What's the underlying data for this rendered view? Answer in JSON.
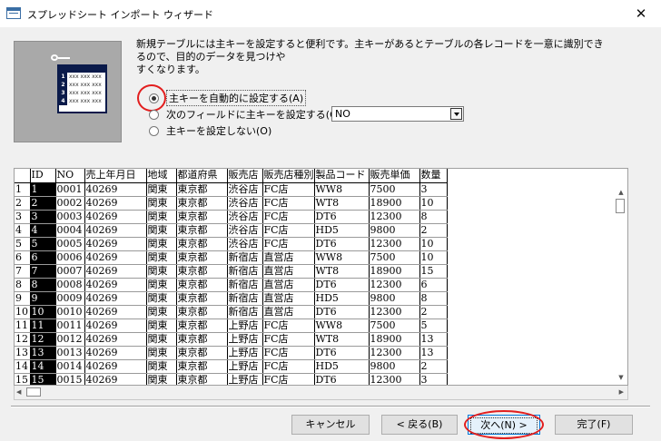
{
  "window": {
    "title": "スプレッドシート インポート ウィザード",
    "close_glyph": "✕"
  },
  "illustration": {
    "rows": [
      {
        "num": "1",
        "text": "xxx xxx xxx"
      },
      {
        "num": "2",
        "text": "xxx xxx xxx"
      },
      {
        "num": "3",
        "text": "xxx xxx xxx"
      },
      {
        "num": "4",
        "text": "xxx xxx xxx"
      }
    ]
  },
  "description": {
    "line1": "新規テーブルには主キーを設定すると便利です。主キーがあるとテーブルの各レコードを一意に識別できるので、目的のデータを見つけや",
    "line2": "すくなります。"
  },
  "options": {
    "auto": {
      "label": "主キーを自動的に設定する(A)",
      "checked": true
    },
    "field": {
      "label": "次のフィールドに主キーを設定する(C)",
      "checked": false
    },
    "none": {
      "label": "主キーを設定しない(O)",
      "checked": false
    },
    "field_select": {
      "value": "NO"
    }
  },
  "grid": {
    "headers": [
      "ID",
      "NO",
      "売上年月日",
      "地域",
      "都道府県",
      "販売店",
      "販売店種別",
      "製品コード",
      "販売単価",
      "数量"
    ],
    "rows": [
      [
        "1",
        "1",
        "0001",
        "40269",
        "関東",
        "東京都",
        "渋谷店",
        "FC店",
        "WW8",
        "7500",
        "3"
      ],
      [
        "2",
        "2",
        "0002",
        "40269",
        "関東",
        "東京都",
        "渋谷店",
        "FC店",
        "WT8",
        "18900",
        "10"
      ],
      [
        "3",
        "3",
        "0003",
        "40269",
        "関東",
        "東京都",
        "渋谷店",
        "FC店",
        "DT6",
        "12300",
        "8"
      ],
      [
        "4",
        "4",
        "0004",
        "40269",
        "関東",
        "東京都",
        "渋谷店",
        "FC店",
        "HD5",
        "9800",
        "2"
      ],
      [
        "5",
        "5",
        "0005",
        "40269",
        "関東",
        "東京都",
        "渋谷店",
        "FC店",
        "DT6",
        "12300",
        "10"
      ],
      [
        "6",
        "6",
        "0006",
        "40269",
        "関東",
        "東京都",
        "新宿店",
        "直営店",
        "WW8",
        "7500",
        "10"
      ],
      [
        "7",
        "7",
        "0007",
        "40269",
        "関東",
        "東京都",
        "新宿店",
        "直営店",
        "WT8",
        "18900",
        "15"
      ],
      [
        "8",
        "8",
        "0008",
        "40269",
        "関東",
        "東京都",
        "新宿店",
        "直営店",
        "DT6",
        "12300",
        "6"
      ],
      [
        "9",
        "9",
        "0009",
        "40269",
        "関東",
        "東京都",
        "新宿店",
        "直営店",
        "HD5",
        "9800",
        "8"
      ],
      [
        "10",
        "10",
        "0010",
        "40269",
        "関東",
        "東京都",
        "新宿店",
        "直営店",
        "DT6",
        "12300",
        "2"
      ],
      [
        "11",
        "11",
        "0011",
        "40269",
        "関東",
        "東京都",
        "上野店",
        "FC店",
        "WW8",
        "7500",
        "5"
      ],
      [
        "12",
        "12",
        "0012",
        "40269",
        "関東",
        "東京都",
        "上野店",
        "FC店",
        "WT8",
        "18900",
        "13"
      ],
      [
        "13",
        "13",
        "0013",
        "40269",
        "関東",
        "東京都",
        "上野店",
        "FC店",
        "DT6",
        "12300",
        "13"
      ],
      [
        "14",
        "14",
        "0014",
        "40269",
        "関東",
        "東京都",
        "上野店",
        "FC店",
        "HD5",
        "9800",
        "2"
      ],
      [
        "15",
        "15",
        "0015",
        "40269",
        "関東",
        "東京都",
        "上野店",
        "FC店",
        "DT6",
        "12300",
        "3"
      ]
    ]
  },
  "buttons": {
    "cancel": "キャンセル",
    "back": "< 戻る(B)",
    "next": "次へ(N) >",
    "finish": "完了(F)"
  },
  "colors": {
    "annotation_red": "#e21e1e",
    "id_column_bg": "#000000",
    "primary_button_border": "#0078d7"
  }
}
